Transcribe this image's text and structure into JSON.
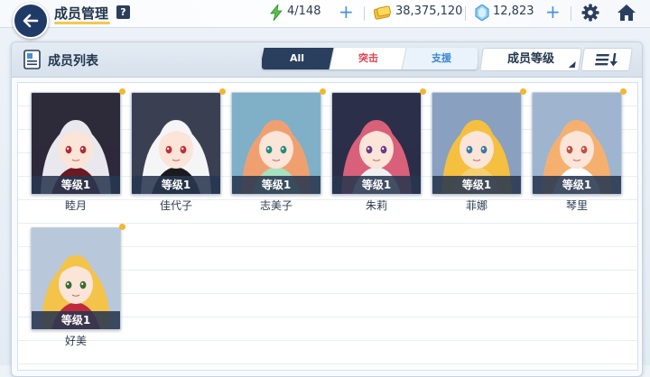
{
  "header": {
    "title": "成员管理",
    "help": "?",
    "ap": "4/148",
    "credits": "38,375,120",
    "gems": "12,823",
    "plus": "+"
  },
  "panel": {
    "title": "成员列表",
    "tabs": [
      "All",
      "突击",
      "支援"
    ],
    "sort_label": "成员等级"
  },
  "members": [
    {
      "name": "睦月",
      "level": "等级1",
      "hair": "#e8e8ee",
      "bg": "#2d2a3a",
      "eyes": "#b02a3a",
      "accent": "#6a1a22"
    },
    {
      "name": "佳代子",
      "level": "等级1",
      "hair": "#f5f5f7",
      "bg": "#3a3f52",
      "eyes": "#c0303a",
      "accent": "#1a1a1f"
    },
    {
      "name": "志美子",
      "level": "等级1",
      "hair": "#f0a070",
      "bg": "#7fb0c8",
      "eyes": "#2a8a7a",
      "accent": "#a8e0c0"
    },
    {
      "name": "朱莉",
      "level": "等级1",
      "hair": "#d9607a",
      "bg": "#2b2f4a",
      "eyes": "#6a3a8a",
      "accent": "#f0f0f0"
    },
    {
      "name": "菲娜",
      "level": "等级1",
      "hair": "#f5c040",
      "bg": "#8aa0c0",
      "eyes": "#3a7aa0",
      "accent": "#f5d070"
    },
    {
      "name": "琴里",
      "level": "等级1",
      "hair": "#f5b070",
      "bg": "#9fb5cf",
      "eyes": "#c05040",
      "accent": "#ffffff"
    },
    {
      "name": "好美",
      "level": "等级1",
      "hair": "#f3c34a",
      "bg": "#b9c7db",
      "eyes": "#3a6a30",
      "accent": "#c02a3a"
    }
  ],
  "colors": {
    "accent": "#f3b72b",
    "navy": "#2a3e5e",
    "strike": "#e04050",
    "support": "#3a86d6"
  }
}
